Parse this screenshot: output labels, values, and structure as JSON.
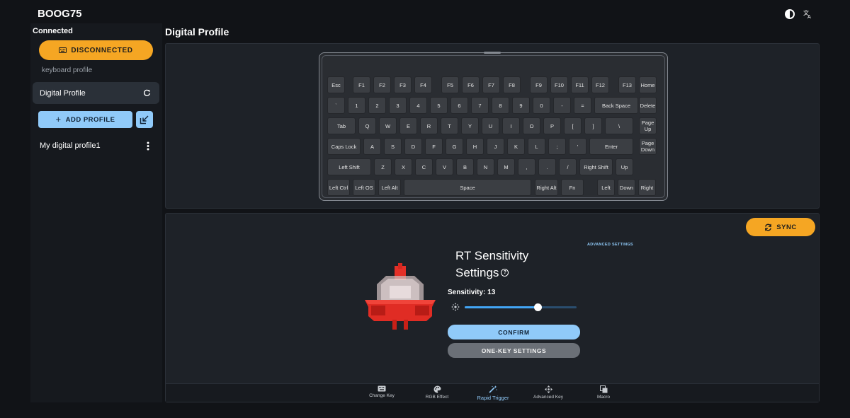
{
  "app": {
    "title": "BOOG75"
  },
  "sidebar": {
    "status": "Connected",
    "disconnect_label": "DISCONNECTED",
    "section_label": "keyboard profile",
    "active_profile": "Digital Profile",
    "add_profile_label": "ADD PROFILE",
    "profiles": [
      "My digital profile1"
    ]
  },
  "main": {
    "title": "Digital Profile",
    "sync_label": "SYNC",
    "advanced_settings_label": "ADVANCED SETTINGS",
    "rt_title_line1": "RT Sensitivity",
    "rt_title_line2": "Settings",
    "sensitivity_label": "Sensitivity: 13",
    "sensitivity_value": 13,
    "sensitivity_fraction": 0.65,
    "confirm_label": "CONFIRM",
    "onekey_label": "ONE-KEY SETTINGS"
  },
  "keyboard": {
    "rows": [
      [
        "Esc",
        "F1",
        "F2",
        "F3",
        "F4",
        "F5",
        "F6",
        "F7",
        "F8",
        "F9",
        "F10",
        "F11",
        "F12",
        "F13",
        "Home"
      ],
      [
        "`",
        "1",
        "2",
        "3",
        "4",
        "5",
        "6",
        "7",
        "8",
        "9",
        "0",
        "-",
        "=",
        "Back Space",
        "Delete"
      ],
      [
        "Tab",
        "Q",
        "W",
        "E",
        "R",
        "T",
        "Y",
        "U",
        "I",
        "O",
        "P",
        "[",
        "]",
        "\\",
        "Page Up"
      ],
      [
        "Caps Lock",
        "A",
        "S",
        "D",
        "F",
        "G",
        "H",
        "J",
        "K",
        "L",
        ";",
        "'",
        "Enter",
        "Page Down"
      ],
      [
        "Left Shift",
        "Z",
        "X",
        "C",
        "V",
        "B",
        "N",
        "M",
        ",",
        ".",
        "/",
        "Right Shift",
        "Up"
      ],
      [
        "Left Ctrl",
        "Left OS",
        "Left Alt",
        "Space",
        "Right Alt",
        "Fn",
        "Left",
        "Down",
        "Right"
      ]
    ]
  },
  "tabs": [
    {
      "label": "Change Key",
      "icon": "keyboard-icon"
    },
    {
      "label": "RGB Effect",
      "icon": "palette-icon"
    },
    {
      "label": "Rapid Trigger",
      "icon": "magic-wand-icon",
      "active": true
    },
    {
      "label": "Advanced Key",
      "icon": "move-arrows-icon"
    },
    {
      "label": "Macro",
      "icon": "copy-icon"
    }
  ],
  "colors": {
    "accent": "#f5a623",
    "primary": "#90caf9",
    "slider": "#42a5f5"
  }
}
